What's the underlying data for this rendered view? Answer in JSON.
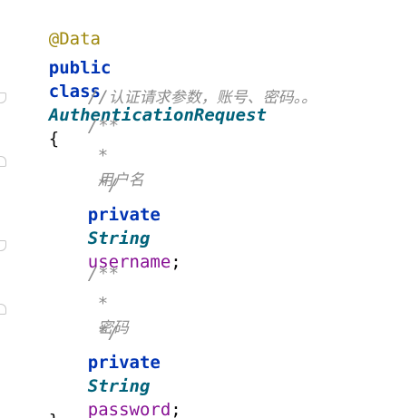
{
  "code": {
    "annotation": "@Data",
    "class_decl": {
      "modifier": "public",
      "keyword": "class",
      "name": "AuthenticationRequest",
      "open_brace": "{"
    },
    "line_comment_prefix": "//",
    "line_comment_text": "认证请求参数，账号、密码。。",
    "field1": {
      "doc_open": "/**",
      "doc_star": "*",
      "doc_text": "用户名",
      "doc_close": "*/",
      "modifier": "private",
      "type": "String",
      "name": "username",
      "semicolon": ";"
    },
    "field2": {
      "doc_open": "/**",
      "doc_star": "*",
      "doc_text": "密码",
      "doc_close": "*/",
      "modifier": "private",
      "type": "String",
      "name": "password",
      "semicolon": ";"
    },
    "close_brace": "}"
  }
}
